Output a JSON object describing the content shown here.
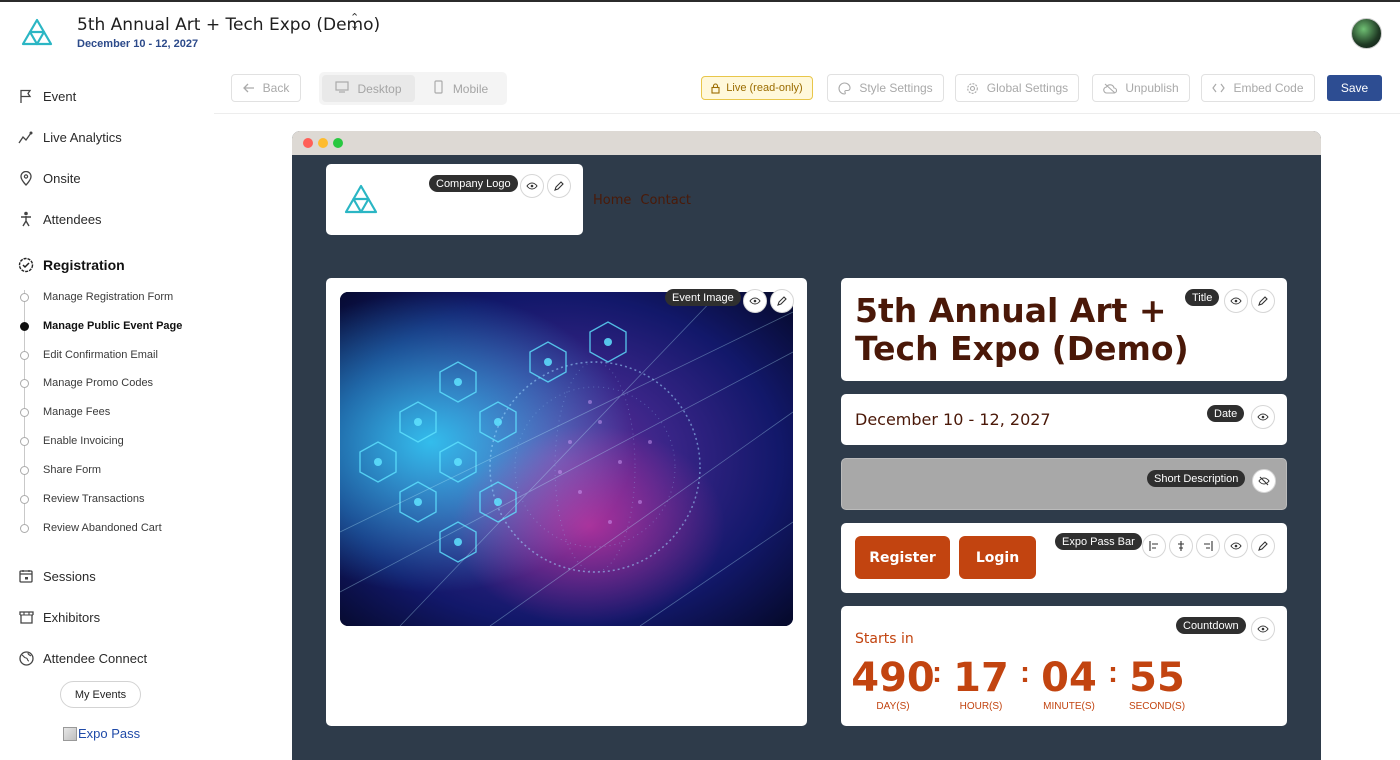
{
  "header": {
    "event_title": "5th Annual Art + Tech Expo (Demo)",
    "event_dates": "December 10 - 12, 2027",
    "switch_icon": "chevron-updown-icon",
    "avatar_icon": "user-avatar"
  },
  "sidebar": {
    "items": [
      {
        "label": "Event",
        "icon": "flag-icon"
      },
      {
        "label": "Live Analytics",
        "icon": "analytics-icon"
      },
      {
        "label": "Onsite",
        "icon": "map-pin-icon"
      },
      {
        "label": "Attendees",
        "icon": "person-icon"
      },
      {
        "label": "Registration",
        "icon": "check-badge-icon"
      },
      {
        "label": "Sessions",
        "icon": "calendar-icon"
      },
      {
        "label": "Exhibitors",
        "icon": "storefront-icon"
      },
      {
        "label": "Attendee Connect",
        "icon": "globe-icon"
      }
    ],
    "registration_subitems": [
      "Manage Registration Form",
      "Manage Public Event Page",
      "Edit Confirmation Email",
      "Manage Promo Codes",
      "Manage Fees",
      "Enable Invoicing",
      "Share Form",
      "Review Transactions",
      "Review Abandoned Cart"
    ],
    "current_subitem": "Manage Public Event Page",
    "my_events": "My Events",
    "expo_pass": "Expo Pass"
  },
  "toolbar": {
    "back": "Back",
    "desktop": "Desktop",
    "mobile": "Mobile",
    "selected_view": "Desktop",
    "live_badge": "Live (read-only)",
    "style_settings": "Style Settings",
    "global_settings": "Global Settings",
    "unpublish": "Unpublish",
    "embed_code": "Embed Code",
    "save": "Save",
    "colors": {
      "save": "#2d4d92",
      "live_border": "#e8c64a"
    }
  },
  "preview": {
    "window_dots": [
      "#ff5f57",
      "#febc2e",
      "#28c840"
    ],
    "nav_links": [
      "Home",
      "Contact"
    ],
    "company_logo_label": "Company Logo",
    "event_image_label": "Event Image",
    "title_label": "Title",
    "title_text": "5th Annual Art + Tech Expo (Demo)",
    "date_label": "Date",
    "date_text": "December 10 - 12, 2027",
    "short_description_label": "Short Description",
    "pass_bar_label": "Expo Pass Bar",
    "register": "Register",
    "login": "Login",
    "countdown_label": "Countdown",
    "starts_in": "Starts in",
    "countdown": {
      "days": "490",
      "days_label": "DAY(S)",
      "hours": "17",
      "hours_label": "HOUR(S)",
      "minutes": "04",
      "minutes_label": "MINUTE(S)",
      "seconds": "55",
      "seconds_label": "SECOND(S)"
    },
    "accent_color": "#c24410",
    "background_color": "#2e3b4a"
  }
}
